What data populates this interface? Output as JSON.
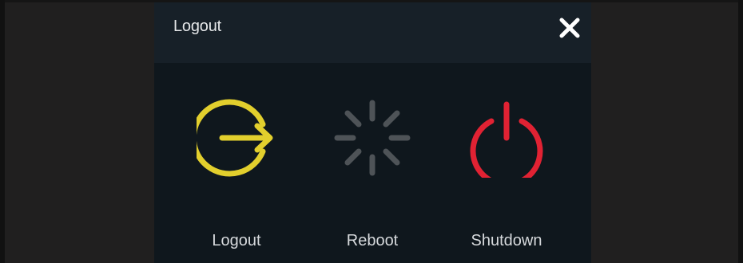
{
  "dialog": {
    "title": "Logout"
  },
  "actions": [
    {
      "label": "Logout",
      "icon": "logout-icon",
      "color": "#e2cf2d"
    },
    {
      "label": "Reboot",
      "icon": "reboot-spinner-icon",
      "color": "#4e5357"
    },
    {
      "label": "Shutdown",
      "icon": "power-icon",
      "color": "#e12233"
    }
  ],
  "colors": {
    "background": "#201f1f",
    "dialog_body": "#0f171d",
    "dialog_header": "#172028",
    "text": "#d6d9dc"
  }
}
